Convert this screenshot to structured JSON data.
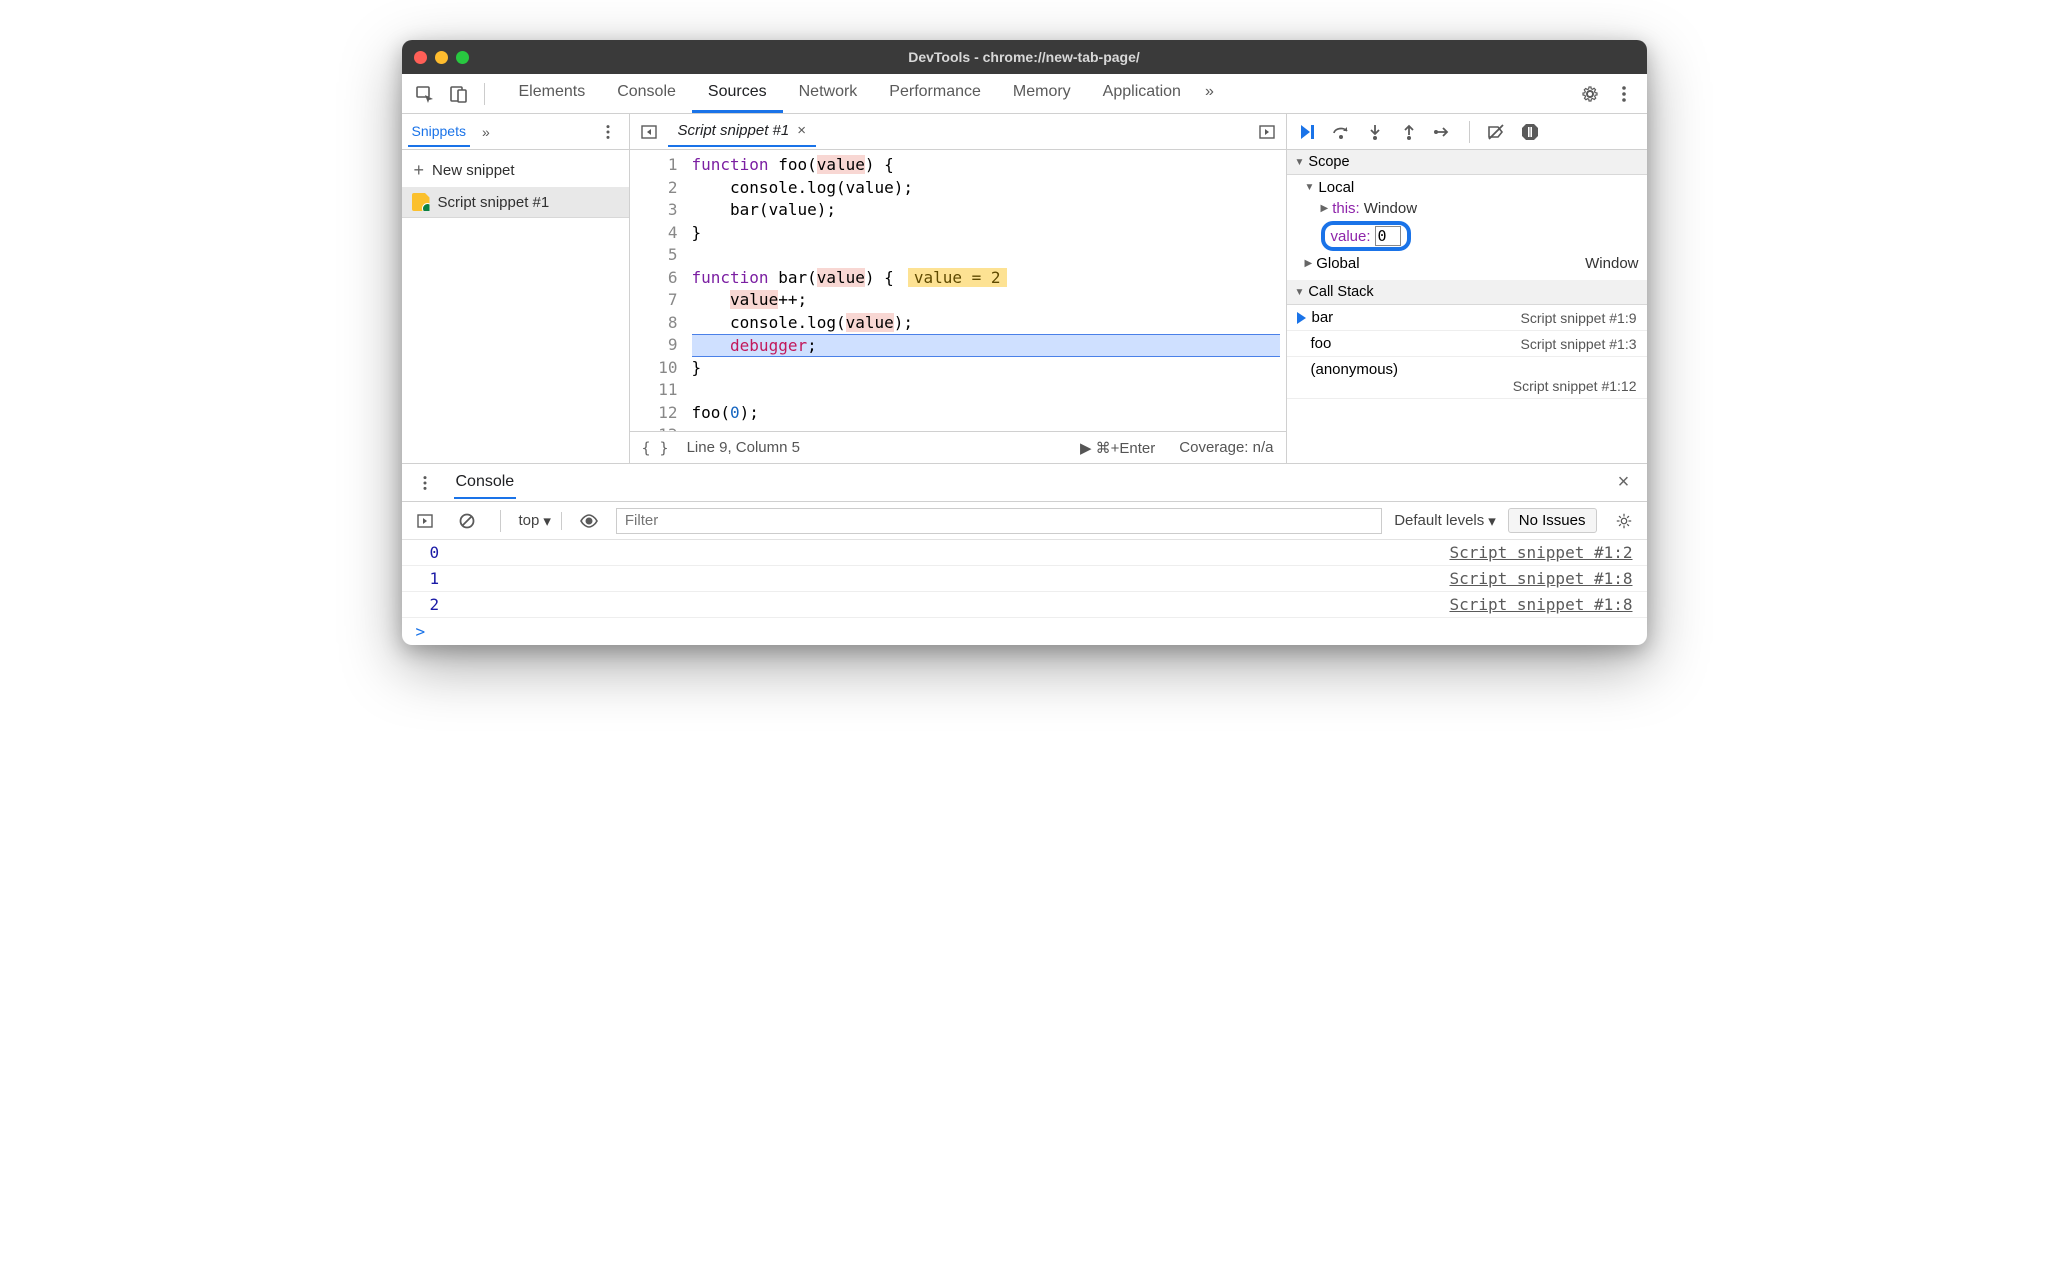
{
  "window_title": "DevTools - chrome://new-tab-page/",
  "main_tabs": [
    "Elements",
    "Console",
    "Sources",
    "Network",
    "Performance",
    "Memory",
    "Application"
  ],
  "active_main_tab": "Sources",
  "overflow_glyph": "»",
  "left_panel": {
    "subtab": "Snippets",
    "new_label": "New snippet",
    "items": [
      "Script snippet #1"
    ]
  },
  "editor": {
    "file_tab": "Script snippet #1",
    "lines": {
      "1": "function foo(value) {",
      "2": "    console.log(value);",
      "3": "    bar(value);",
      "4": "}",
      "5": "",
      "6": "function bar(value) {",
      "6_hint": "value = 2",
      "7": "    value++;",
      "8": "    console.log(value);",
      "9_pre": "    ",
      "9_kw": "debugger",
      "9_post": ";",
      "10": "}",
      "11": "",
      "12a": "foo(",
      "12b": "0",
      "12c": ");",
      "13": ""
    },
    "status_left": "Line 9, Column 5",
    "run_label": "⌘+Enter",
    "coverage": "Coverage: n/a"
  },
  "debugger": {
    "scope_title": "Scope",
    "local_title": "Local",
    "this_label": "this",
    "this_value": "Window",
    "value_label": "value",
    "value_edit": "0",
    "global_label": "Global",
    "global_value": "Window",
    "callstack_title": "Call Stack",
    "stack": [
      {
        "fn": "bar",
        "loc": "Script snippet #1:9",
        "current": true
      },
      {
        "fn": "foo",
        "loc": "Script snippet #1:3",
        "current": false
      },
      {
        "fn": "(anonymous)",
        "loc": "Script snippet #1:12",
        "current": false
      }
    ]
  },
  "drawer": {
    "tab": "Console",
    "context": "top",
    "filter_placeholder": "Filter",
    "levels": "Default levels",
    "issues": "No Issues",
    "rows": [
      {
        "v": "0",
        "src": "Script snippet #1:2"
      },
      {
        "v": "1",
        "src": "Script snippet #1:8"
      },
      {
        "v": "2",
        "src": "Script snippet #1:8"
      }
    ],
    "prompt": ">"
  }
}
